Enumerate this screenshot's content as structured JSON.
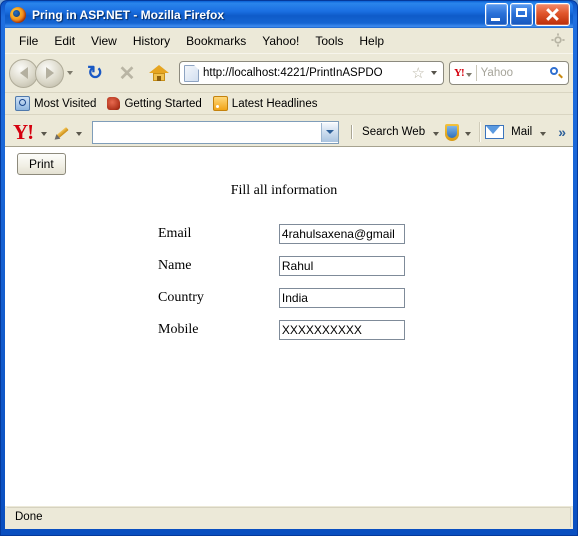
{
  "window": {
    "title": "Pring in ASP.NET - Mozilla Firefox",
    "app_icon": "firefox-icon",
    "controls": {
      "minimize": "minimize-icon",
      "maximize": "maximize-icon",
      "close": "close-icon"
    },
    "accent_titlebar": "#0b62d6",
    "chrome_bg": "#ece9d8"
  },
  "menu": {
    "items": [
      {
        "label": "File"
      },
      {
        "label": "Edit"
      },
      {
        "label": "View"
      },
      {
        "label": "History"
      },
      {
        "label": "Bookmarks"
      },
      {
        "label": "Yahoo!"
      },
      {
        "label": "Tools"
      },
      {
        "label": "Help"
      }
    ]
  },
  "navbar": {
    "back": "back-arrow-icon",
    "forward": "forward-arrow-icon",
    "history_dropdown": "chevron-down-icon",
    "reload": "reload-icon",
    "stop": "stop-icon",
    "home": "home-icon",
    "url": {
      "value": "http://localhost:4221/PrintInASPDO",
      "favicon": "page-icon",
      "bookmark_star": "star-icon",
      "dropdown": "chevron-down-icon"
    },
    "search": {
      "engine": "Y!",
      "placeholder": "Yahoo",
      "value": "",
      "icon": "magnifier-icon"
    }
  },
  "bookmarks_toolbar": {
    "items": [
      {
        "label": "Most Visited",
        "icon": "most-visited-icon"
      },
      {
        "label": "Getting Started",
        "icon": "firefox-head-icon"
      },
      {
        "label": "Latest Headlines",
        "icon": "rss-feed-icon"
      }
    ]
  },
  "yahoo_toolbar": {
    "logo": "Y!",
    "pencil": "pencil-icon",
    "search_value": "",
    "search_dropdown": "chevron-down-icon",
    "search_web_label": "Search Web",
    "shield": "shield-icon",
    "mail_label": "Mail",
    "mail_icon": "envelope-icon",
    "overflow": "»"
  },
  "page": {
    "print_button": "Print",
    "heading": "Fill all information",
    "fields": [
      {
        "label": "Email",
        "value": "4rahulsaxena@gmail"
      },
      {
        "label": "Name",
        "value": "Rahul"
      },
      {
        "label": "Country",
        "value": "India"
      },
      {
        "label": "Mobile",
        "value": "XXXXXXXXXX"
      }
    ]
  },
  "statusbar": {
    "text": "Done"
  }
}
